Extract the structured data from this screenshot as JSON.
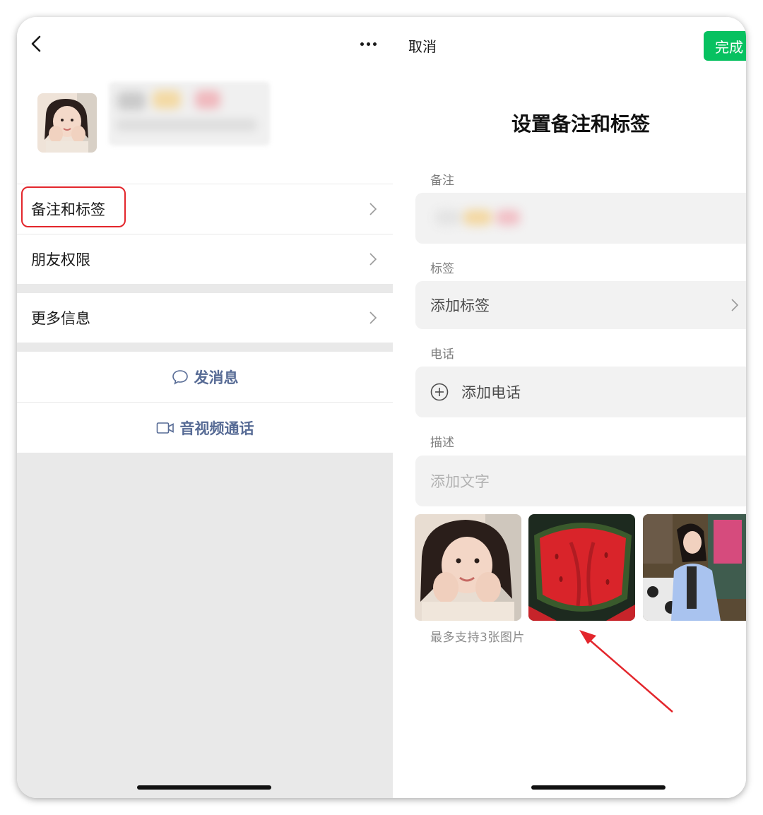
{
  "left": {
    "menu_items": [
      {
        "label": "备注和标签"
      },
      {
        "label": "朋友权限"
      },
      {
        "label": "更多信息"
      }
    ],
    "actions": {
      "message_label": "发消息",
      "call_label": "音视频通话"
    }
  },
  "right": {
    "cancel_label": "取消",
    "done_label": "完成",
    "title": "设置备注和标签",
    "remark_label": "备注",
    "tag_label": "标签",
    "add_tag_label": "添加标签",
    "phone_label": "电话",
    "add_phone_label": "添加电话",
    "desc_label": "描述",
    "desc_placeholder": "添加文字",
    "photo_hint": "最多支持3张图片"
  },
  "colors": {
    "accent_green": "#07c160",
    "link_blue": "#576b95",
    "highlight_red": "#e3262c"
  },
  "icons": [
    "back-icon",
    "more-icon",
    "chevron-right-icon",
    "chat-bubble-icon",
    "video-call-icon",
    "plus-circle-icon",
    "annotation-arrow"
  ]
}
